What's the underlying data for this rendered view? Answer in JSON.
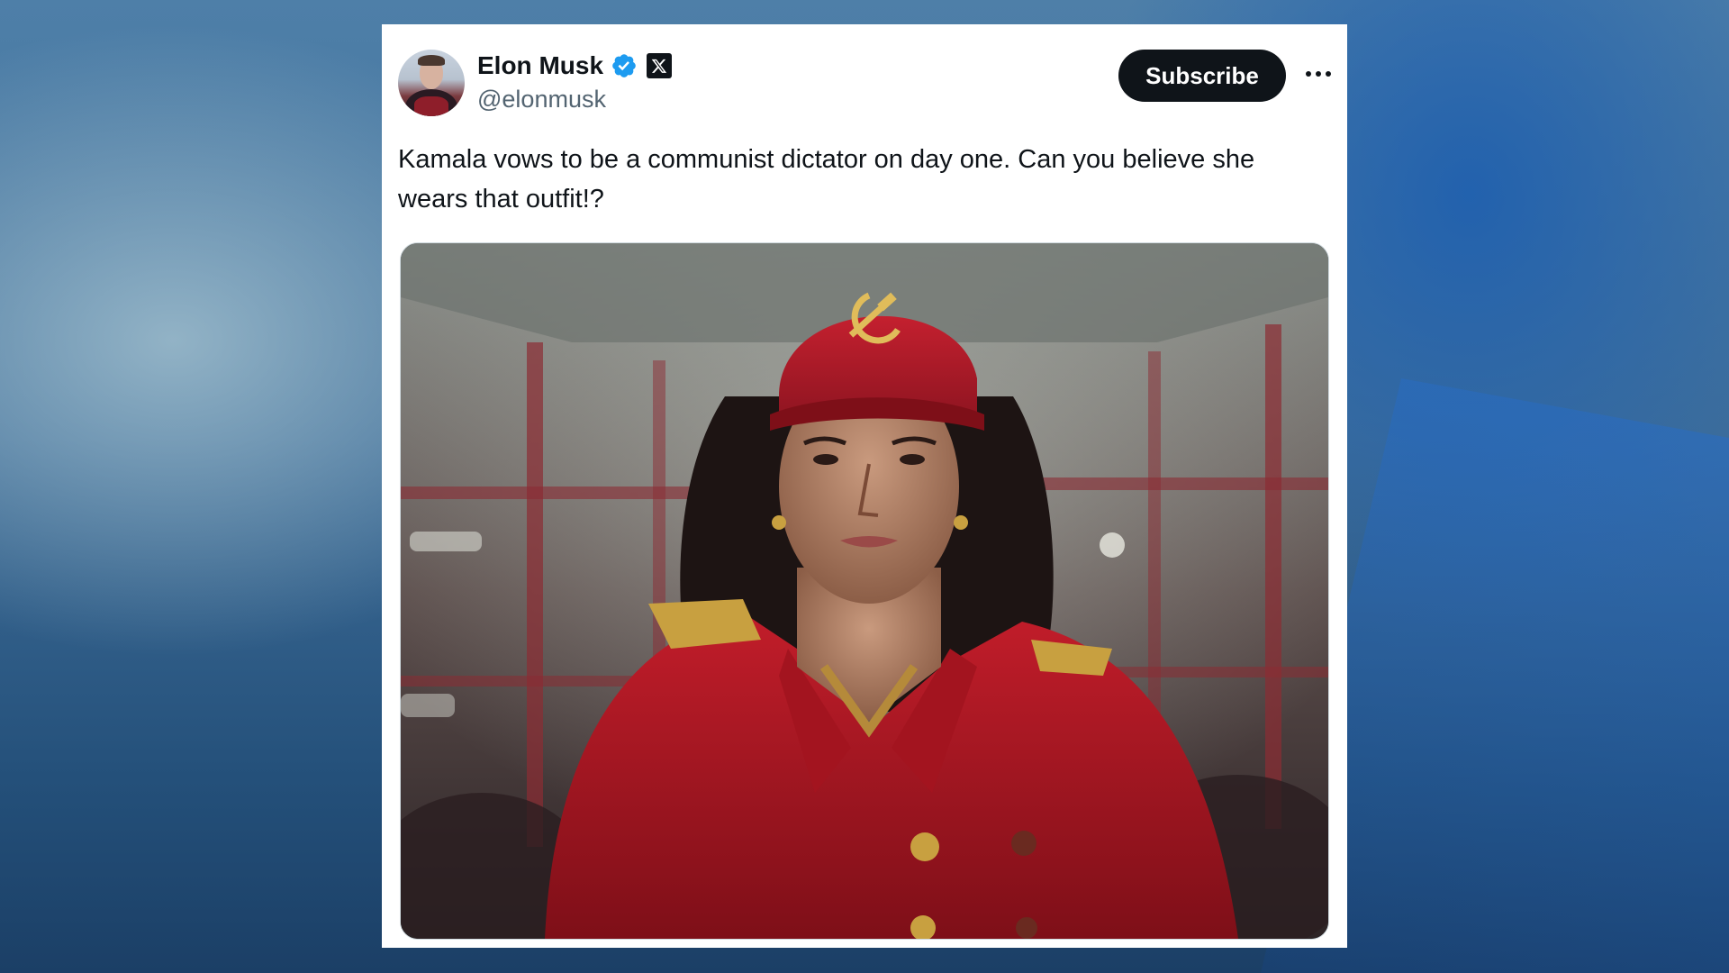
{
  "post": {
    "author": {
      "name": "Elon Musk",
      "handle": "@elonmusk",
      "verified": true,
      "affiliate_badge_icon": "x-logo-icon"
    },
    "subscribe_label": "Subscribe",
    "more_icon": "more-horizontal-icon",
    "text": "Kamala vows to be a communist dictator on day one. Can you believe she wears that outfit!?"
  },
  "colors": {
    "background": "#3f6e99",
    "card": "#ffffff",
    "text_primary": "#0f1419",
    "text_secondary": "#536471",
    "verified_blue": "#1d9bf0",
    "button_dark": "#0f1419"
  }
}
